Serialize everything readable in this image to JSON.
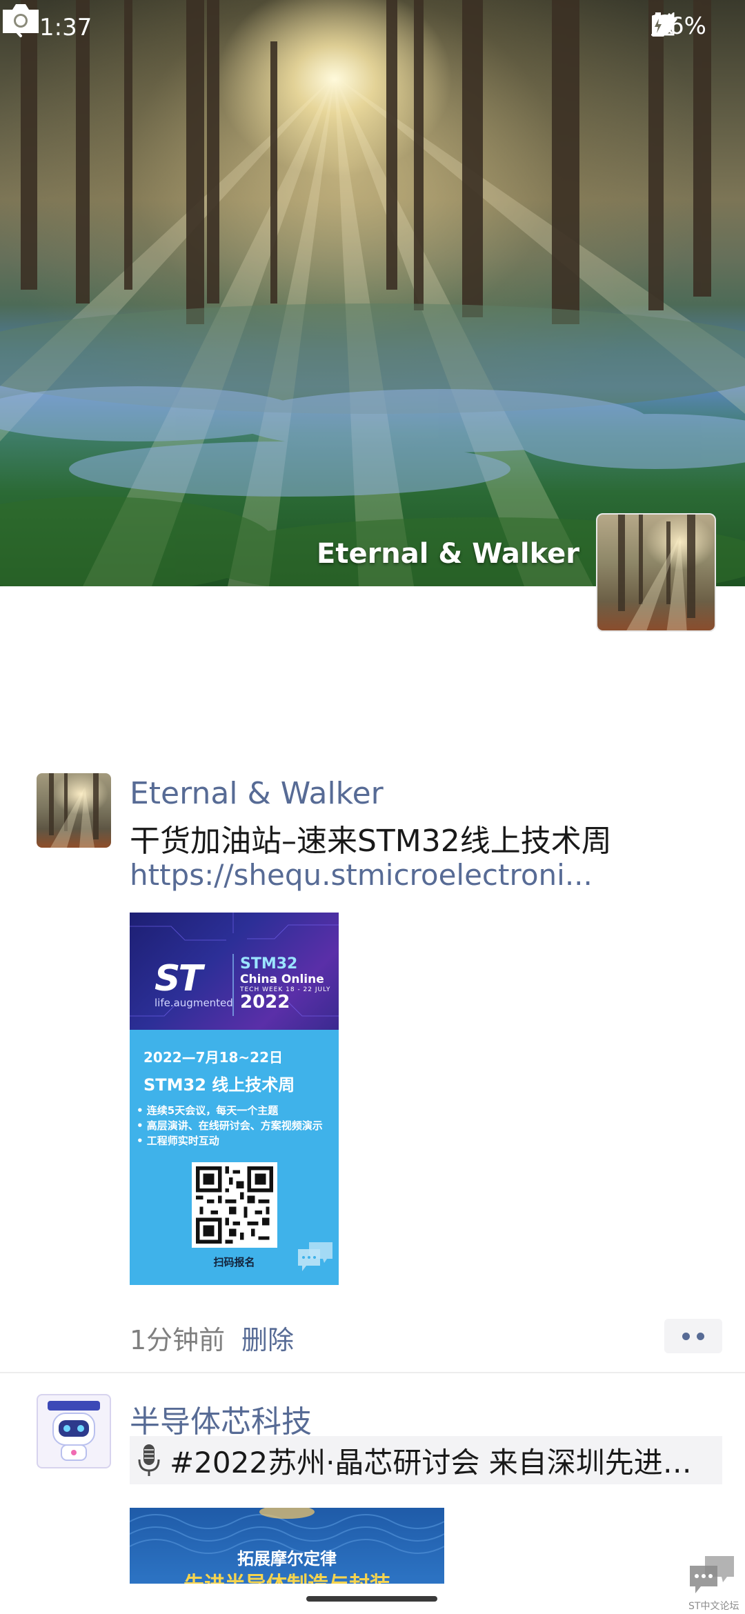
{
  "status_bar": {
    "time": "1:37",
    "battery": "86%",
    "icons": [
      "alarm-icon",
      "wifi-icon",
      "cellular-no-signal-icon",
      "battery-charging-icon"
    ]
  },
  "header": {
    "back_icon": "chevron-left-icon",
    "camera_icon": "camera-icon",
    "cover_name": "Eternal & Walker"
  },
  "posts": [
    {
      "author": "Eternal & Walker",
      "text": "干货加油站–速来STM32线上技术周",
      "link": "https://shequ.stmicroelectroni...",
      "poster": {
        "logo": "ST",
        "tagline": "life.augmented",
        "badge_line1": "STM32",
        "badge_line2": "China Online",
        "badge_line3": "TECH WEEK 18 - 22 JULY",
        "badge_year": "2022",
        "date": "2022—7月18~22日",
        "title": "STM32 线上技术周",
        "bullets": [
          "• 连续5天会议，每天一个主题",
          "• 高层演讲、在线研讨会、方案视频演示",
          "• 工程师实时互动"
        ],
        "scan_label": "扫码报名"
      },
      "time": "1分钟前",
      "delete_label": "删除"
    },
    {
      "author": "半导体芯科技",
      "share_text": "#2022苏州·晶芯研讨会 来自深圳先进…",
      "banner_line1": "拓展摩尔定律",
      "banner_line2": "先进半导体制造与封装"
    }
  ],
  "watermark": {
    "text": "ST中文论坛"
  },
  "colors": {
    "link_blue": "#576b95",
    "text_dark": "#191919",
    "meta_gray": "#7f7f7f",
    "poster_blue": "#3fb2ea"
  }
}
